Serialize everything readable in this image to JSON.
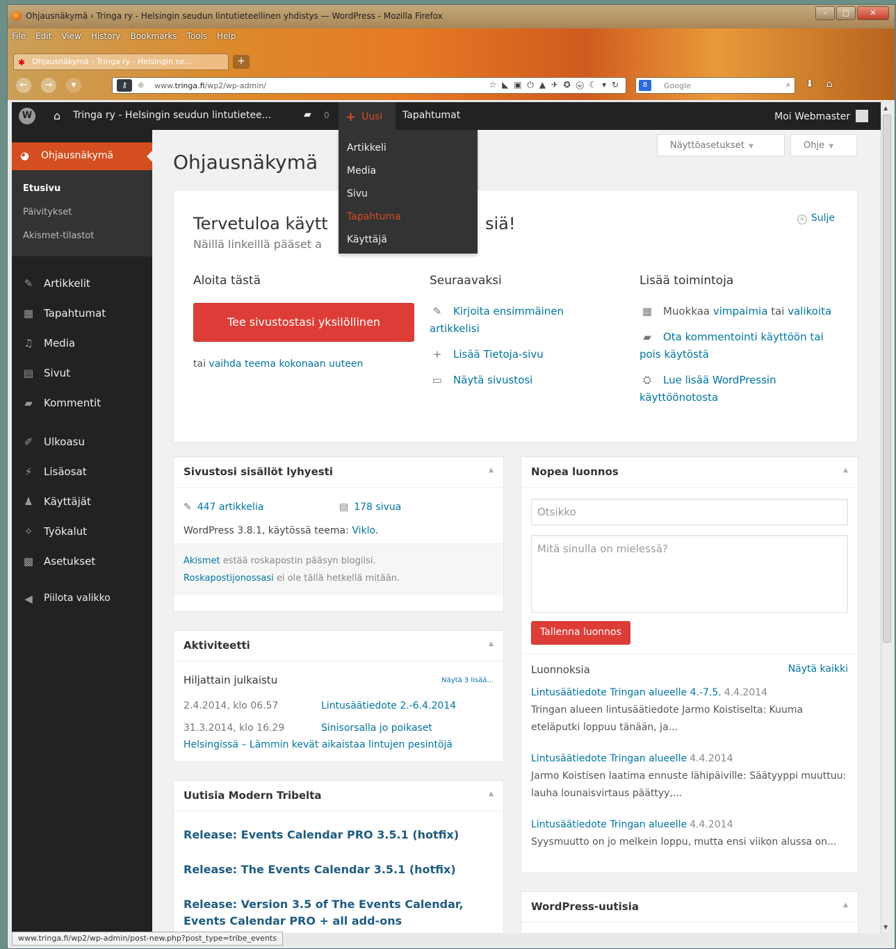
{
  "browser": {
    "title": "Ohjausnäkymä ‹ Tringa ry - Helsingin seudun lintutieteellinen yhdistys — WordPress - Mozilla Firefox",
    "menu": [
      "File",
      "Edit",
      "View",
      "History",
      "Bookmarks",
      "Tools",
      "Help"
    ],
    "tab_title": "Ohjausnäkymä ‹ Tringa ry - Helsingin se...",
    "new_tab": "+",
    "url_prefix": "www.",
    "url_domain": "tringa.fi",
    "url_path": "/wp2/wp-admin/",
    "search_placeholder": "Google",
    "status_url": "www.tringa.fi/wp2/wp-admin/post-new.php?post_type=tribe_events"
  },
  "adminbar": {
    "site_name": "Tringa ry - Helsingin seudun lintutietee...",
    "comments_count": "0",
    "new_label": "Uusi",
    "events_label": "Tapahtumat",
    "howdy": "Moi Webmaster",
    "new_menu": [
      "Artikkeli",
      "Media",
      "Sivu",
      "Tapahtuma",
      "Käyttäjä"
    ]
  },
  "sidebar": {
    "active": "Ohjausnäkymä",
    "submenu": [
      "Etusivu",
      "Päivitykset",
      "Akismet-tilastot"
    ],
    "items": [
      "Artikkelit",
      "Tapahtumat",
      "Media",
      "Sivut",
      "Kommentit",
      "Ulkoasu",
      "Lisäosat",
      "Käyttäjät",
      "Työkalut",
      "Asetukset",
      "Piilota valikko"
    ]
  },
  "main": {
    "title": "Ohjausnäkymä",
    "screen_options": "Näyttöasetukset",
    "help": "Ohje",
    "welcome": {
      "title_start": "Tervetuloa käytt",
      "title_end": "siä!",
      "subtitle": "Näillä linkeillä pääset a",
      "close": "Sulje",
      "col1_title": "Aloita tästä",
      "button": "Tee sivustostasi yksilöllinen",
      "alt_prefix": "tai",
      "alt_link": "vaihda teema kokonaan uuteen",
      "col2_title": "Seuraavaksi",
      "next_1": "Kirjoita ensimmäinen artikkelisi",
      "next_2": "Lisää Tietoja-sivu",
      "next_3": "Näytä sivustosi",
      "col3_title": "Lisää toimintoja",
      "more_1_a": "Muokkaa",
      "more_1_b": "vimpaimia",
      "more_1_c": "tai",
      "more_1_d": "valikoita",
      "more_2": "Ota kommentointi käyttöön tai pois käytöstä",
      "more_3": "Lue lisää WordPressin käyttöönotosta"
    },
    "glance": {
      "title": "Sivustosi sisällöt lyhyesti",
      "posts": "447 artikkelia",
      "pages": "178 sivua",
      "version_text": "WordPress 3.8.1, käytössä teema:",
      "theme": "Viklo",
      "akismet_link": "Akismet",
      "akismet_text": "estää roskapostin pääsyn blogiisi.",
      "spam_link": "Roskapostijonossasi",
      "spam_text": "ei ole tällä hetkellä mitään."
    },
    "activity": {
      "title": "Aktiviteetti",
      "recent": "Hiljattain julkaistu",
      "more": "Näytä 3 lisää...",
      "row1_date": "2.4.2014, klo 06.57",
      "row1_title": "Lintusäätiedote 2.-6.4.2014",
      "row2_date": "31.3.2014, klo 16.29",
      "row2_title_a": "Sinisorsalla jo poikaset",
      "row2_title_b": "Helsingissä – Lämmin kevät aikaistaa lintujen pesintöjä"
    },
    "news": {
      "title": "Uutisia Modern Tribelta",
      "items": [
        "Release: Events Calendar PRO 3.5.1 (hotfix)",
        "Release: The Events Calendar 3.5.1 (hotfix)",
        "Release: Version 3.5 of The Events Calendar, Events Calendar PRO + all add-ons"
      ]
    },
    "quick": {
      "title": "Nopea luonnos",
      "title_placeholder": "Otsikko",
      "content_placeholder": "Mitä sinulla on mielessä?",
      "save": "Tallenna luonnos",
      "drafts_title": "Luonnoksia",
      "view_all": "Näytä kaikki",
      "drafts": [
        {
          "title": "Lintusäätiedote Tringan alueelle 4.-7.5.",
          "date": "4.4.2014",
          "excerpt": "Tringan alueen lintusäätiedote Jarmo Koistiselta: Kuuma eteläputki loppuu tänään, ja..."
        },
        {
          "title": "Lintusäätiedote Tringan alueelle",
          "date": "4.4.2014",
          "excerpt": "Jarmo Koistisen laatima ennuste lähipäiville: Säätyyppi muuttuu: lauha lounaisvirtaus päättyy,..."
        },
        {
          "title": "Lintusäätiedote Tringan alueelle",
          "date": "4.4.2014",
          "excerpt": "Syysmuutto on jo melkein loppu, mutta ensi viikon alussa on..."
        }
      ]
    },
    "wpnews": {
      "title": "WordPress-uutisia"
    }
  }
}
